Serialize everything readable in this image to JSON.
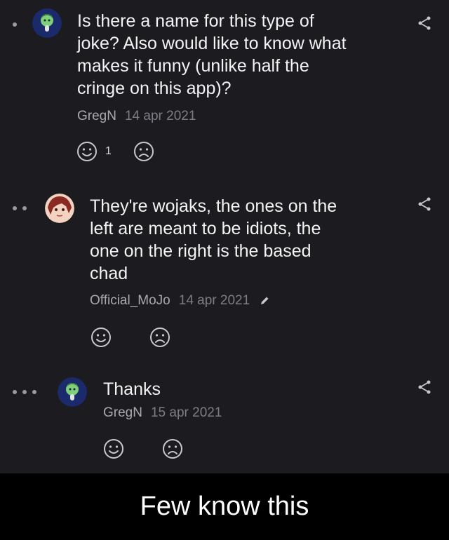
{
  "comments": [
    {
      "author": "GregN",
      "date": "14 apr 2021",
      "text": "Is there a name for this type of joke? Also would like to know what makes it funny (unlike half the cringe on this app)?",
      "lines": [
        "Is there a name for this type of",
        "joke? Also would like to know what",
        "makes it funny (unlike half the",
        "cringe on this app)?"
      ],
      "smile_count": "1",
      "depth": 1,
      "avatar_icon": "wojak-avatar-icon"
    },
    {
      "author": "Official_MoJo",
      "date": "14 apr 2021",
      "text": "They're wojaks, the ones on the left are meant to be idiots, the one on the right is the based chad",
      "lines": [
        "They're wojaks, the ones on the",
        "left are meant to be idiots, the",
        "one on the right is the based",
        "chad"
      ],
      "edited": true,
      "depth": 2,
      "avatar_icon": "anime-avatar-icon"
    },
    {
      "author": "GregN",
      "date": "15 apr 2021",
      "text": "Thanks",
      "lines": [
        "Thanks"
      ],
      "depth": 3,
      "avatar_icon": "wojak-avatar-icon"
    }
  ],
  "caption": "Few know this",
  "colors": {
    "background": "#1c1c20",
    "text": "#f3f3f3",
    "meta": "#a9a9b0",
    "icon": "#c8c8cc",
    "banner": "#000000"
  }
}
